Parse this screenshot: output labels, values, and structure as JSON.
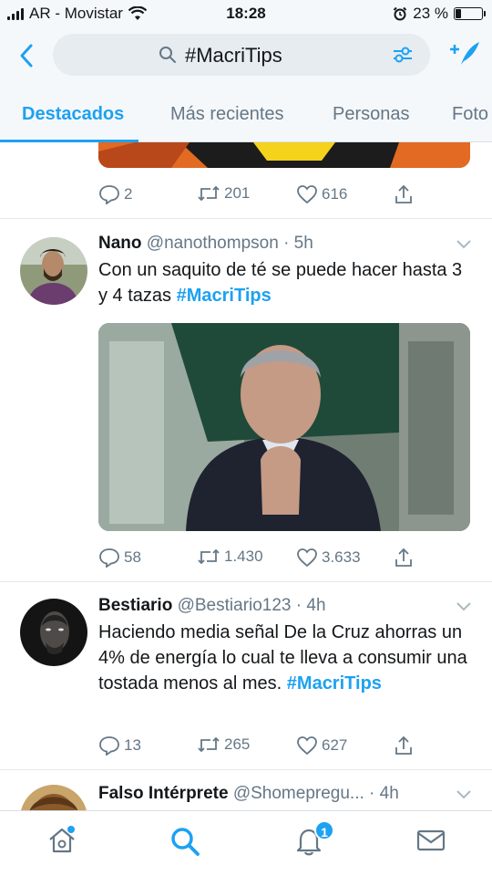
{
  "status_bar": {
    "carrier": "AR - Movistar",
    "time": "18:28",
    "battery": "23 %",
    "battery_level": 0.23
  },
  "search": {
    "query": "#MacriTips",
    "icons": [
      "back-arrow-icon",
      "search-icon",
      "filter-icon",
      "compose-icon"
    ]
  },
  "tabs": [
    "Destacados",
    "Más recientes",
    "Personas",
    "Foto"
  ],
  "colors": {
    "accent": "#1da1f2",
    "muted": "#657786",
    "text": "#14171a"
  },
  "tweet0": {
    "replies": "2",
    "retweets": "201",
    "likes": "616"
  },
  "tweet1": {
    "name": "Nano",
    "handle": "@nanothompson",
    "time": "· 5h",
    "text": "Con un saquito de té se puede hacer hasta 3 y 4 tazas",
    "hashtag": "#MacriTips",
    "replies": "58",
    "retweets": "1.430",
    "likes": "3.633"
  },
  "tweet2": {
    "name": "Bestiario",
    "handle": "@Bestiario123",
    "time": "· 4h",
    "text": "Haciendo media señal De la Cruz ahorras un 4% de energía lo cual te lleva a consumir una tostada menos al mes.",
    "hashtag": "#MacriTips",
    "replies": "13",
    "retweets": "265",
    "likes": "627"
  },
  "tweet3": {
    "name": "Falso Intérprete",
    "handle": "@Shomepregu...",
    "time": "· 4h"
  },
  "bottom_nav": {
    "notifications_badge": "1",
    "icons": [
      "home-icon",
      "search-icon",
      "notifications-icon",
      "messages-icon"
    ]
  }
}
